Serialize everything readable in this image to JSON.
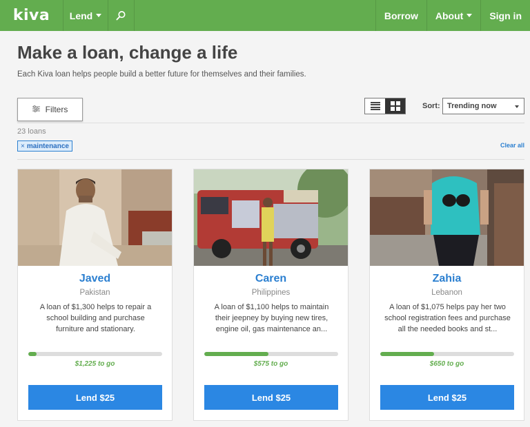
{
  "nav": {
    "logo": "kiva",
    "lend_label": "Lend",
    "search_icon": "search-icon",
    "right_items": [
      {
        "label": "Borrow",
        "dropdown": false
      },
      {
        "label": "About",
        "dropdown": true
      },
      {
        "label": "Sign in",
        "dropdown": false
      }
    ],
    "color": "#63ad4f"
  },
  "header": {
    "title": "Make a loan, change a life",
    "subtitle": "Each Kiva loan helps people build a better future for themselves and their families."
  },
  "toolbar": {
    "filters_label": "Filters",
    "sort_label": "Sort:",
    "sort_value": "Trending now",
    "view_mode": "grid"
  },
  "results": {
    "count": "23 loans",
    "tag": "maintenance",
    "tag_remove": "×",
    "clear_all": "Clear all"
  },
  "loans": [
    {
      "name": "Javed",
      "country": "Pakistan",
      "description": "A loan of $1,300 helps to repair a school building and purchase furniture and stationary.",
      "progress": 0.06,
      "to_go": "$1,225 to go",
      "button": "Lend $25"
    },
    {
      "name": "Caren",
      "country": "Philippines",
      "description": "A loan of $1,100 helps to maintain their jeepney by buying new tires, engine oil, gas maintenance an...",
      "progress": 0.48,
      "to_go": "$575 to go",
      "button": "Lend $25"
    },
    {
      "name": "Zahia",
      "country": "Lebanon",
      "description": "A loan of $1,075 helps pay her two school registration fees and purchase all the needed books and st...",
      "progress": 0.4,
      "to_go": "$650 to go",
      "button": "Lend $25"
    }
  ],
  "colors": {
    "link_blue": "#2b7fd0",
    "button_blue": "#2b87e3",
    "progress_green": "#63ad4f"
  }
}
